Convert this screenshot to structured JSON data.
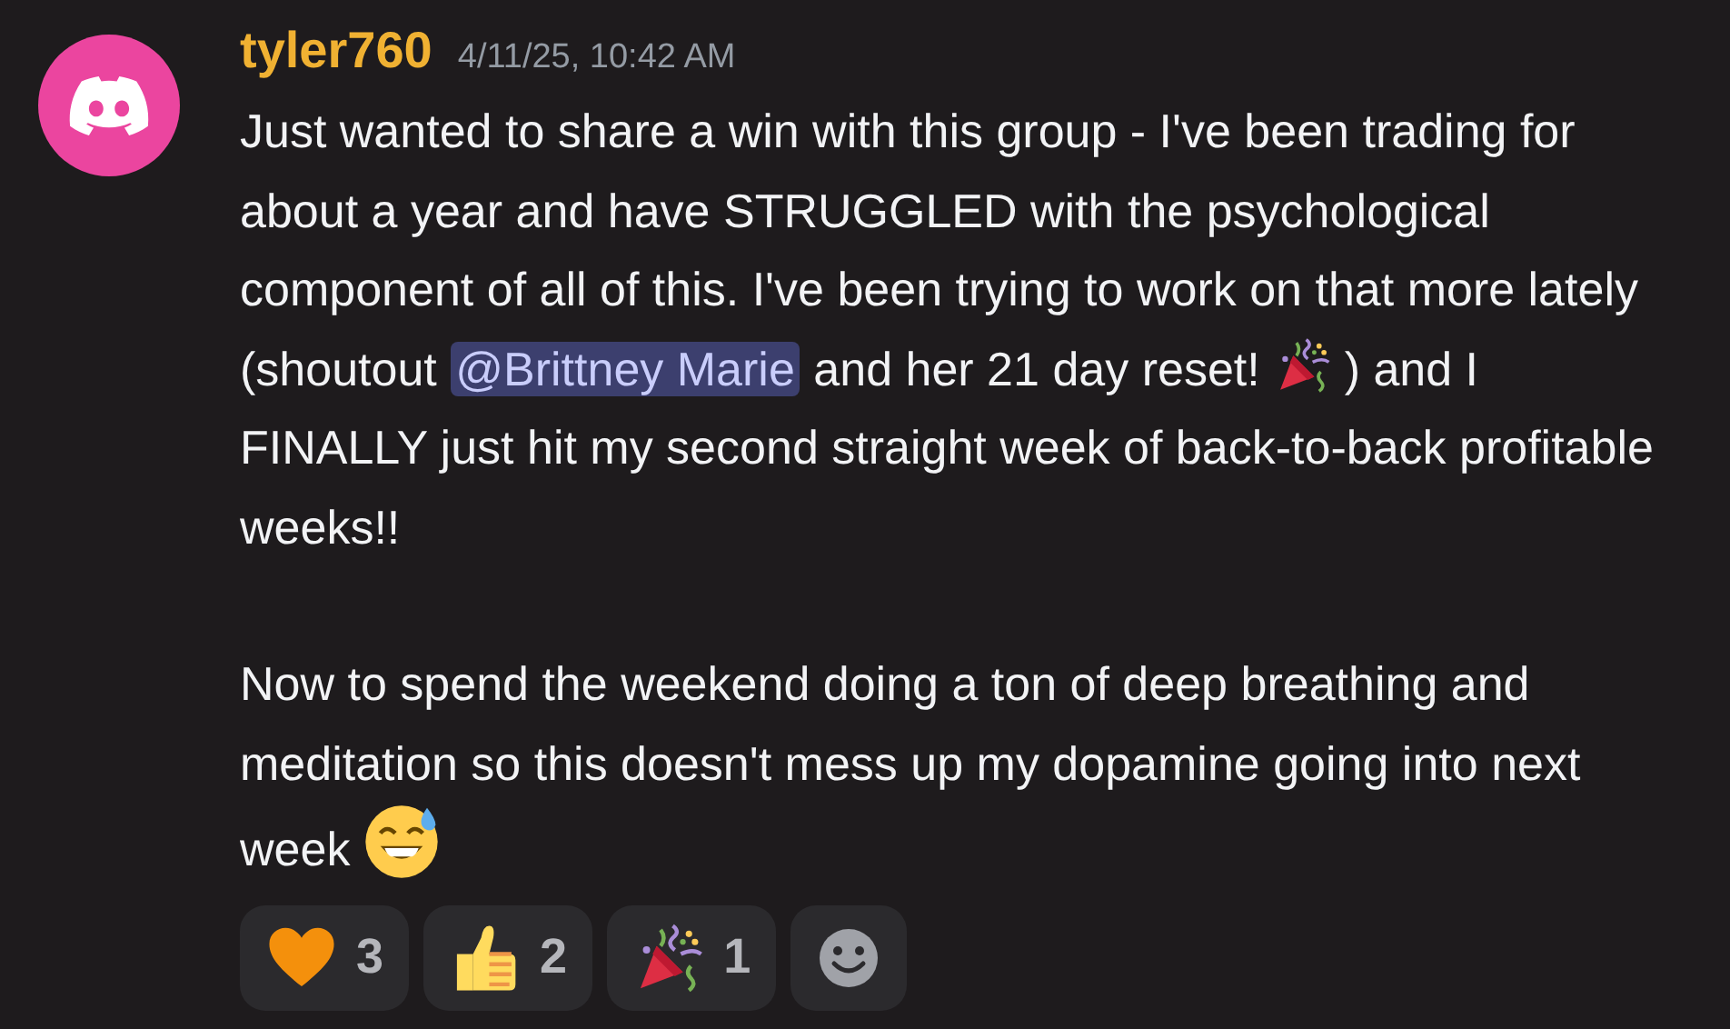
{
  "message": {
    "author": "tyler760",
    "timestamp": "4/11/25, 10:42 AM",
    "paragraphs": [
      {
        "segments": [
          {
            "kind": "text",
            "text": "Just wanted to share a win with this group - I've been trading for about a year and have STRUGGLED with the psychological component of all of this. I've been trying to work on that more lately (shoutout "
          },
          {
            "kind": "mention",
            "text": "@Brittney Marie"
          },
          {
            "kind": "text",
            "text": " and her 21 day reset! "
          },
          {
            "kind": "party"
          },
          {
            "kind": "text",
            "text": " ) and I FINALLY just hit my second straight week of back-to-back profitable weeks!!"
          }
        ]
      },
      {
        "segments": [
          {
            "kind": "text",
            "text": "Now to spend the weekend doing a ton of deep breathing and meditation so this doesn't mess up my dopamine going into next week "
          },
          {
            "kind": "sweat-smile"
          }
        ]
      }
    ],
    "reactions": [
      {
        "kind": "heart",
        "count": "3"
      },
      {
        "kind": "thumbs-up",
        "count": "2"
      },
      {
        "kind": "party",
        "count": "1"
      },
      {
        "kind": "add"
      }
    ]
  }
}
